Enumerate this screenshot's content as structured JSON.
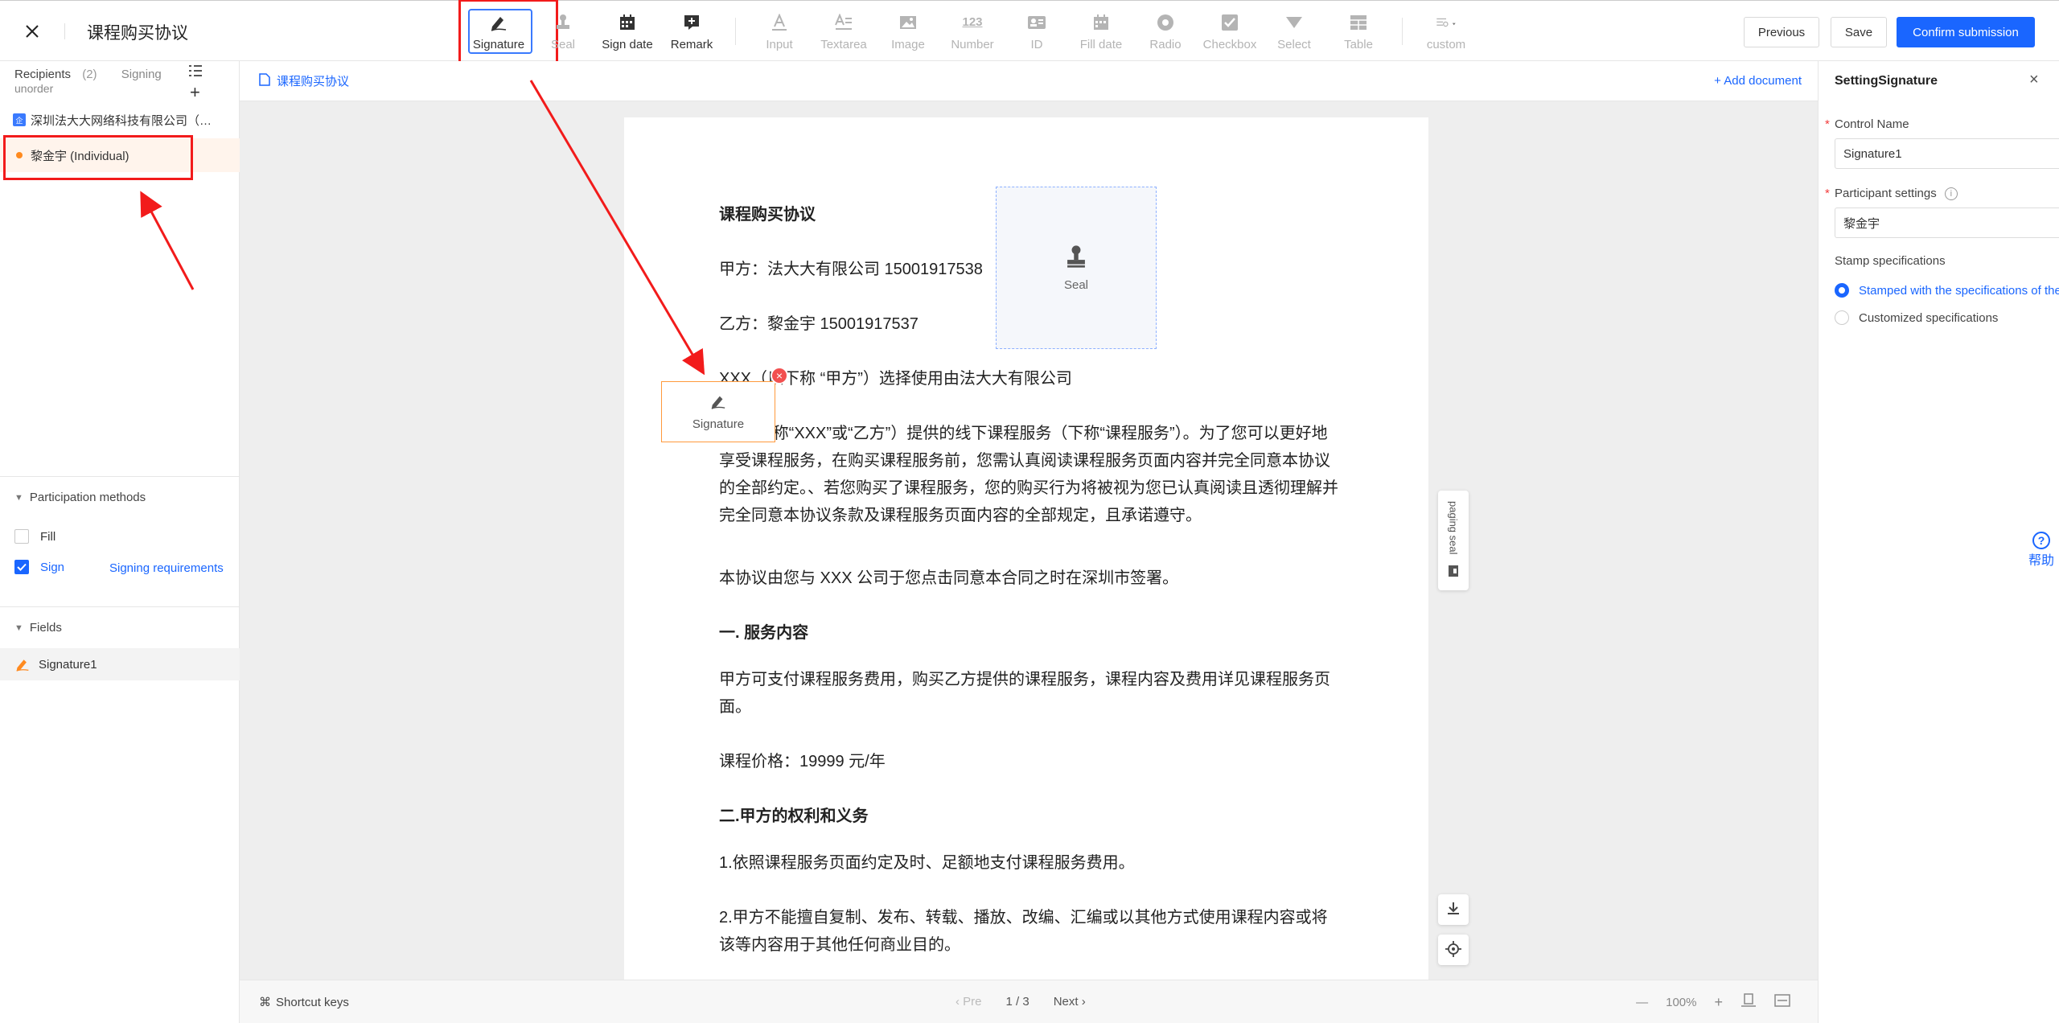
{
  "header": {
    "title": "课程购买协议",
    "previous": "Previous",
    "save": "Save",
    "confirm": "Confirm submission"
  },
  "toolbar": [
    {
      "label": "Signature",
      "icon": "signature-pen-icon",
      "state": "active"
    },
    {
      "label": "Seal",
      "icon": "seal-stamp-icon",
      "state": "disabled"
    },
    {
      "label": "Sign date",
      "icon": "calendar-icon",
      "state": "enabled"
    },
    {
      "label": "Remark",
      "icon": "remark-plus-icon",
      "state": "enabled"
    },
    {
      "label": "Input",
      "icon": "input-text-icon",
      "state": "disabled"
    },
    {
      "label": "Textarea",
      "icon": "textarea-icon",
      "state": "disabled"
    },
    {
      "label": "Image",
      "icon": "image-icon",
      "state": "disabled"
    },
    {
      "label": "Number",
      "icon": "number-123-icon",
      "state": "disabled",
      "glyph": "123"
    },
    {
      "label": "ID",
      "icon": "id-card-icon",
      "state": "disabled"
    },
    {
      "label": "Fill date",
      "icon": "fill-date-icon",
      "state": "disabled"
    },
    {
      "label": "Radio",
      "icon": "radio-icon",
      "state": "disabled"
    },
    {
      "label": "Checkbox",
      "icon": "checkbox-icon",
      "state": "disabled"
    },
    {
      "label": "Select",
      "icon": "select-arrow-icon",
      "state": "disabled"
    },
    {
      "label": "Table",
      "icon": "table-icon",
      "state": "disabled"
    },
    {
      "label": "custom",
      "icon": "custom-settings-icon",
      "state": "disabled"
    }
  ],
  "recipients": {
    "label": "Recipients",
    "count": "(2)",
    "signing": "Signing",
    "order_mode": "unorder",
    "company_badge": "企",
    "items": [
      {
        "name": "深圳法大大网络科技有限公司（…",
        "type": "company"
      },
      {
        "name": "黎金宇 (Individual)",
        "type": "individual",
        "selected": true
      }
    ]
  },
  "participation": {
    "title": "Participation methods",
    "fill": "Fill",
    "fill_checked": false,
    "sign": "Sign",
    "sign_checked": true,
    "requirements": "Signing requirements"
  },
  "fields": {
    "title": "Fields",
    "items": [
      "Signature1"
    ]
  },
  "document": {
    "tab": "课程购买协议",
    "add_document": "+ Add document",
    "seal_label": "Seal",
    "signature_label": "Signature",
    "paging_seal": "paging seal",
    "lines": [
      {
        "text": "课程购买协议",
        "bold": true
      },
      {
        "text": "甲方：法大大有限公司  15001917538",
        "bold": false
      },
      {
        "text": "乙方：黎金宇    15001917537",
        "bold": false
      },
      {
        "text": "XXX（以下称 “甲方”）选择使用由法大大有限公司",
        "bold": false
      },
      {
        "text": "公司(下称“XXX”或“乙方”）提供的线下课程服务（下称“课程服务”）。为了您可以更好地享受课程服务，在购买课程服务前，您需认真阅读课程服务页面内容并完全同意本协议的全部约定。、若您购买了课程服务，您的购买行为将被视为您已认真阅读且透彻理解并完全同意本协议条款及课程服务页面内容的全部规定，且承诺遵守。",
        "bold": false
      },
      {
        "text": "本协议由您与 XXX 公司于您点击同意本合同之时在深圳市签署。",
        "bold": false
      },
      {
        "text": "一.  服务内容",
        "bold": true
      },
      {
        "text": "甲方可支付课程服务费用，购买乙方提供的课程服务，课程内容及费用详见课程服务页面。",
        "bold": false
      },
      {
        "text": "课程价格：19999 元/年",
        "bold": false
      },
      {
        "text": "二.甲方的权利和义务",
        "bold": true
      },
      {
        "text": "1.依照课程服务页面约定及时、足额地支付课程服务费用。",
        "bold": false
      },
      {
        "text": "2.甲方不能擅自复制、发布、转载、播放、改编、汇编或以其他方式使用课程内容或将该等内容用于其他任何商业目的。",
        "bold": false
      }
    ]
  },
  "footer": {
    "shortcut": "Shortcut keys",
    "pre": "‹  Pre",
    "page": "1  /  3",
    "next": "Next  ›",
    "zoom_out": "—",
    "zoom": "100%",
    "zoom_in": "+"
  },
  "settings": {
    "title": "SettingSignature",
    "control_name_label": "Control Name",
    "control_name_value": "Signature1",
    "participant_label": "Participant settings",
    "participant_value": "黎金宇",
    "stamp_label": "Stamp specifications",
    "stamp_opt1": "Stamped with the specifications of the seal",
    "stamp_opt2": "Customized specifications"
  },
  "help": {
    "label": "帮助"
  },
  "colors": {
    "accent": "#1a66ff",
    "annotation": "#f21b1b",
    "field_border": "#ff9a3c"
  }
}
